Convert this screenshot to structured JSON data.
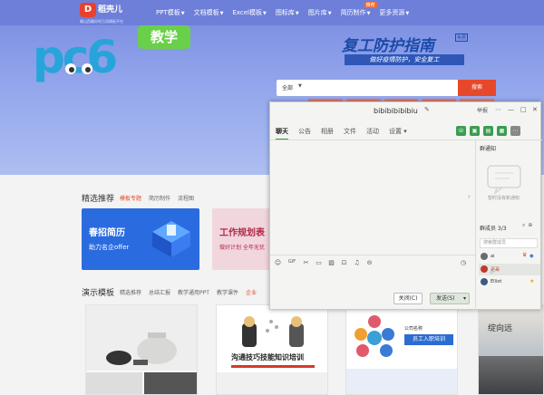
{
  "site": {
    "brand": {
      "mark": "D",
      "name": "稻壳儿",
      "slogan": "最山西最好的万用模板平台"
    },
    "nav": [
      {
        "label": "PPT模板"
      },
      {
        "label": "文档模板"
      },
      {
        "label": "Excel模板"
      },
      {
        "label": "图标库"
      },
      {
        "label": "图片库"
      },
      {
        "label": "简历制作"
      },
      {
        "label": "更多资源"
      }
    ],
    "nav_badge": "推荐",
    "logo_text": "pc6",
    "edu_badge": "教学",
    "promo": {
      "title": "复工防护指南",
      "free": "免费",
      "subtitle": "做好疫情防护，安全复工"
    },
    "search": {
      "select": "全部",
      "button": "搜索"
    },
    "featured": {
      "title": "精选推荐",
      "tabs": [
        "模板专题",
        "简历制作",
        "流程图"
      ]
    },
    "cards": {
      "spring": {
        "title": "春招简历",
        "subtitle": "助力名企offer"
      },
      "work": {
        "title": "工作规划表",
        "subtitle": "做好计划 全年无忧"
      }
    },
    "demo": {
      "title": "演示模板",
      "tabs": [
        "精选推荐",
        "总结汇报",
        "教学通用PPT",
        "教学课件",
        "企业"
      ]
    },
    "template_texts": {
      "comm": "沟通技巧技能知识培训",
      "company": "公司名称",
      "onboard": "员工入职培训",
      "brush": "绽向远"
    }
  },
  "chat": {
    "title": "bibibibibibiu",
    "window_controls": [
      "举报",
      "⋯",
      "—",
      "□",
      "✕"
    ],
    "tabs": [
      "聊天",
      "公告",
      "相册",
      "文件",
      "活动",
      "设置"
    ],
    "active_tab": "聊天",
    "side": {
      "notice_label": "群通知",
      "notice_empty": "暂时没有新通知",
      "members_label": "群成员 3/3",
      "search_placeholder": "搜索群成员",
      "members": [
        {
          "name": "ai",
          "color": "#6b6b6b"
        },
        {
          "name": "哥哥",
          "color": "#c0392b",
          "highlight": true
        },
        {
          "name": "Elliot",
          "color": "#3d5a80"
        }
      ]
    },
    "buttons": {
      "close": "关闭(C)",
      "send": "发送(S)"
    }
  }
}
